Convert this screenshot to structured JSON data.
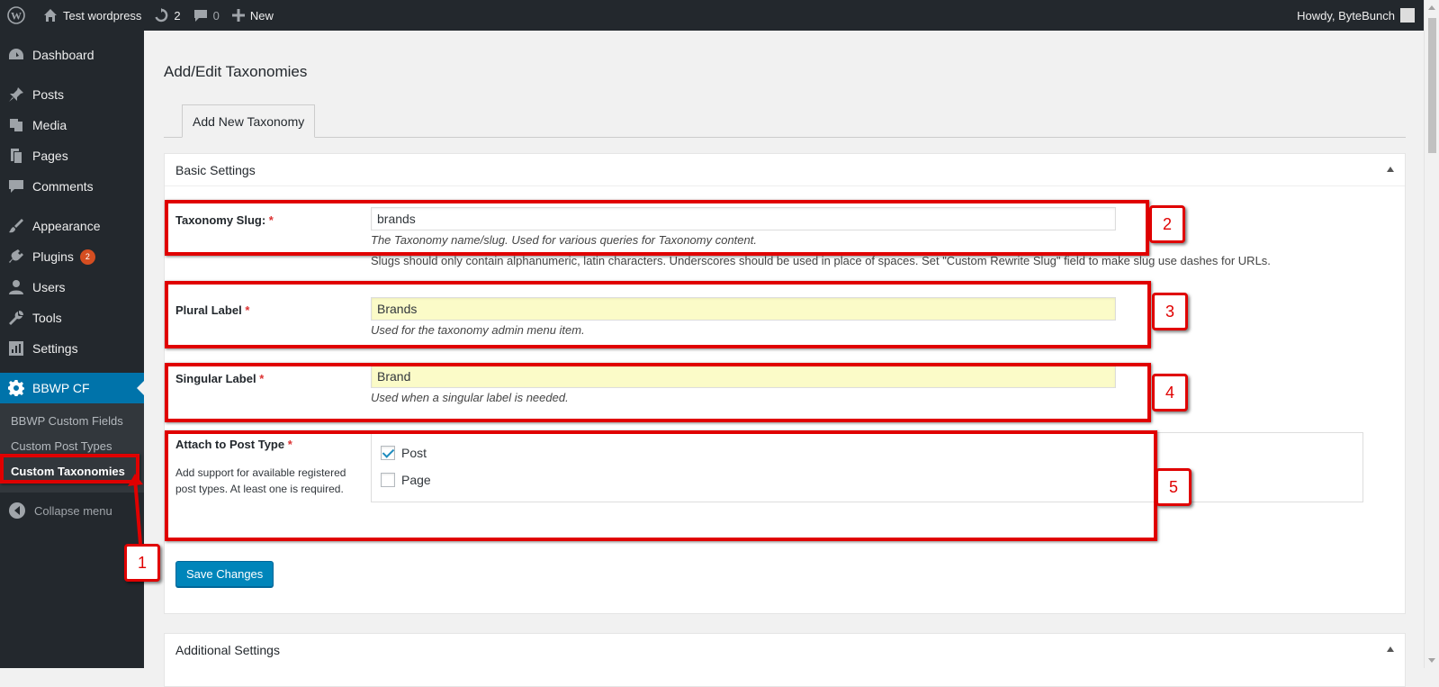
{
  "adminbar": {
    "site_name": "Test wordpress",
    "updates_count": "2",
    "comments_count": "0",
    "new_label": "New",
    "howdy": "Howdy, ByteBunch"
  },
  "sidebar": {
    "items": [
      {
        "label": "Dashboard",
        "icon": "dashboard-icon"
      },
      {
        "label": "Posts",
        "icon": "pin-icon"
      },
      {
        "label": "Media",
        "icon": "media-icon"
      },
      {
        "label": "Pages",
        "icon": "pages-icon"
      },
      {
        "label": "Comments",
        "icon": "comment-icon"
      },
      {
        "label": "Appearance",
        "icon": "brush-icon"
      },
      {
        "label": "Plugins",
        "icon": "plug-icon",
        "badge": "2"
      },
      {
        "label": "Users",
        "icon": "user-icon"
      },
      {
        "label": "Tools",
        "icon": "wrench-icon"
      },
      {
        "label": "Settings",
        "icon": "settings-icon"
      },
      {
        "label": "BBWP CF",
        "icon": "gear-icon"
      }
    ],
    "submenu": [
      "BBWP Custom Fields",
      "Custom Post Types",
      "Custom Taxonomies"
    ],
    "collapse_label": "Collapse menu"
  },
  "main": {
    "title": "Add/Edit Taxonomies",
    "tab_label": "Add New Taxonomy",
    "basic_settings": {
      "heading": "Basic Settings",
      "slug": {
        "label": "Taxonomy Slug:",
        "required": "*",
        "value": "brands",
        "description": "The Taxonomy name/slug. Used for various queries for Taxonomy content.",
        "note": "Slugs should only contain alphanumeric, latin characters. Underscores should be used in place of spaces. Set \"Custom Rewrite Slug\" field to make slug use dashes for URLs."
      },
      "plural": {
        "label": "Plural Label",
        "required": "*",
        "value": "Brands",
        "description": "Used for the taxonomy admin menu item."
      },
      "singular": {
        "label": "Singular Label",
        "required": "*",
        "value": "Brand",
        "description": "Used when a singular label is needed."
      },
      "attach": {
        "label": "Attach to Post Type",
        "required": "*",
        "description": "Add support for available registered post types. At least one is required.",
        "options": [
          {
            "label": "Post",
            "checked": true
          },
          {
            "label": "Page",
            "checked": false
          }
        ]
      },
      "save_label": "Save Changes"
    },
    "additional_settings": {
      "heading": "Additional Settings"
    }
  },
  "annotations": [
    "1",
    "2",
    "3",
    "4",
    "5"
  ],
  "colors": {
    "admin_dark": "#23282d",
    "accent_blue": "#0073aa",
    "annotation_red": "#e00000",
    "badge_orange": "#d54e21"
  }
}
